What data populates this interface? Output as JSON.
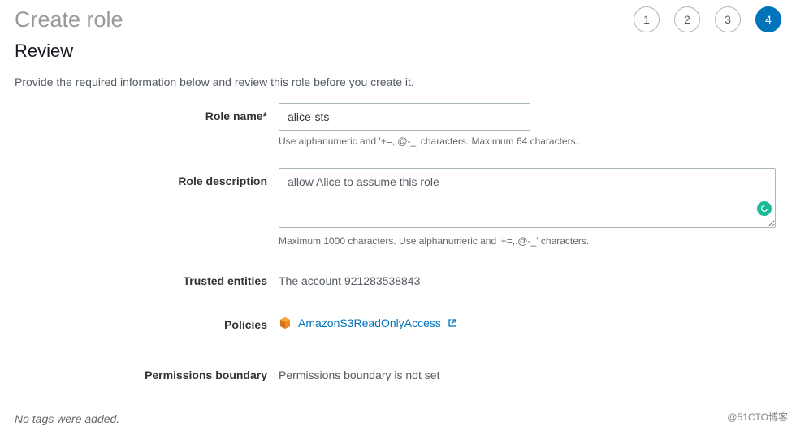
{
  "page": {
    "title": "Create role"
  },
  "steps": {
    "items": [
      "1",
      "2",
      "3",
      "4"
    ],
    "active_index": 3
  },
  "section": {
    "title": "Review",
    "description": "Provide the required information below and review this role before you create it."
  },
  "form": {
    "role_name": {
      "label": "Role name*",
      "value": "alice-sts",
      "help": "Use alphanumeric and '+=,.@-_' characters. Maximum 64 characters."
    },
    "role_description": {
      "label": "Role description",
      "value": "allow Alice to assume this role",
      "help": "Maximum 1000 characters. Use alphanumeric and '+=,.@-_' characters."
    },
    "trusted_entities": {
      "label": "Trusted entities",
      "value": "The account 921283538843"
    },
    "policies": {
      "label": "Policies",
      "link_text": "AmazonS3ReadOnlyAccess",
      "icon": "box-icon"
    },
    "permissions_boundary": {
      "label": "Permissions boundary",
      "value": "Permissions boundary is not set"
    }
  },
  "tags_footer": "No tags were added.",
  "watermark": "@51CTO博客"
}
